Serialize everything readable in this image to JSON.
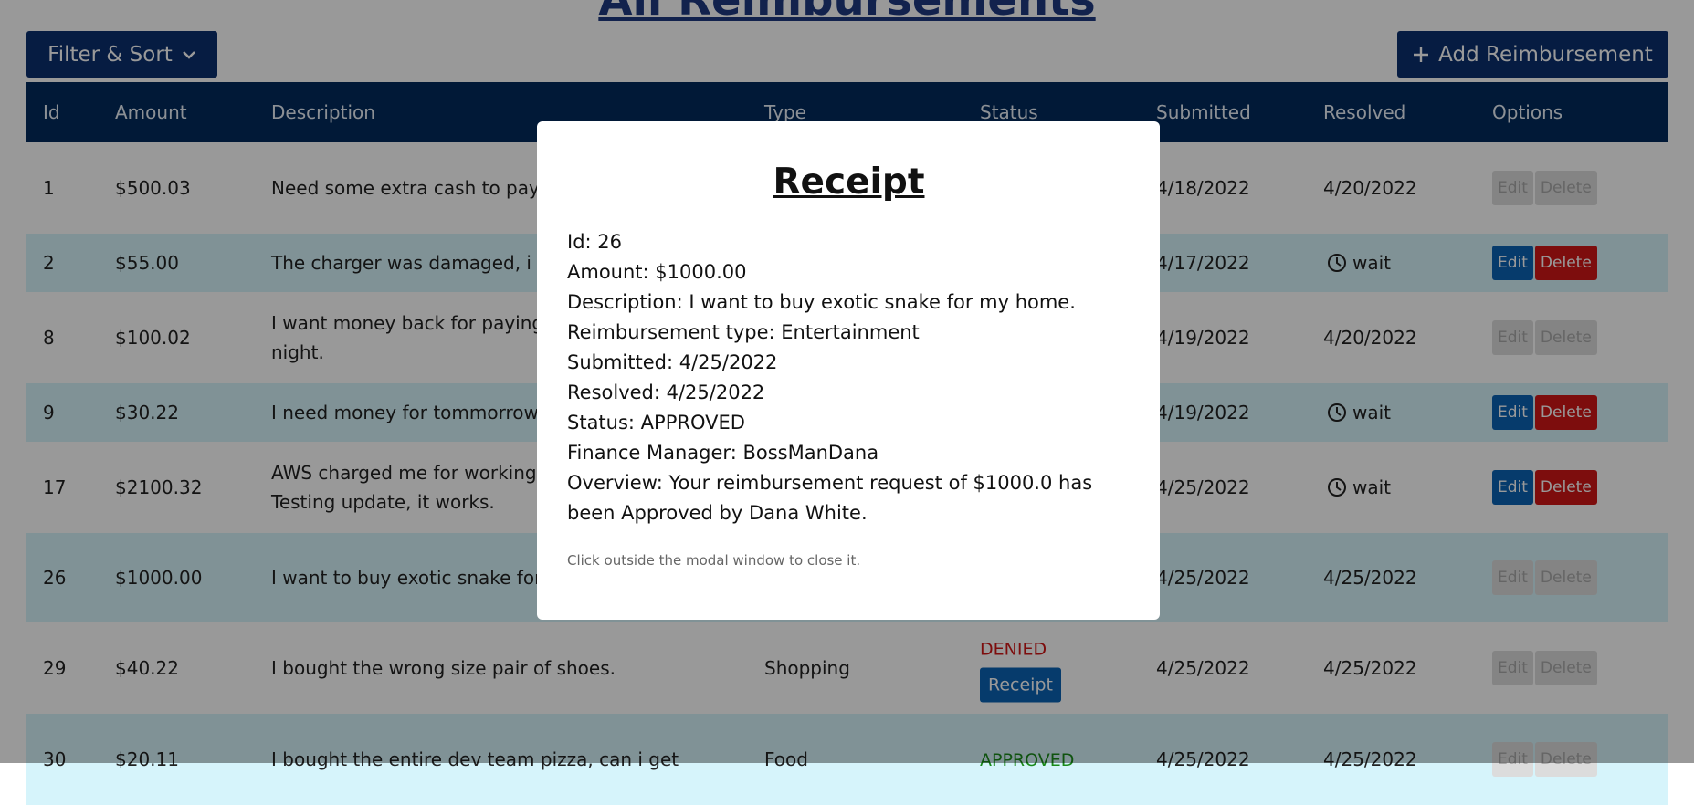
{
  "page": {
    "title": "All Reimbursements",
    "filter_label": "Filter & Sort",
    "add_label": "Add Reimbursement"
  },
  "table": {
    "columns": [
      "Id",
      "Amount",
      "Description",
      "Type",
      "Status",
      "Submitted",
      "Resolved",
      "Options"
    ],
    "rows": [
      {
        "id": "1",
        "amount": "$500.03",
        "description": "Need some extra cash to pay r",
        "submitted": "4/18/2022",
        "resolved": "4/20/2022"
      },
      {
        "id": "2",
        "amount": "$55.00",
        "description": "The charger was damaged, i w",
        "submitted": "4/17/2022",
        "resolved": "wait"
      },
      {
        "id": "8",
        "amount": "$100.02",
        "description": "I want money back for paying",
        "description2": "night.",
        "submitted": "4/19/2022",
        "resolved": "4/20/2022"
      },
      {
        "id": "9",
        "amount": "$30.22",
        "description": "I need money for tommorrow l",
        "submitted": "4/19/2022",
        "resolved": "wait"
      },
      {
        "id": "17",
        "amount": "$2100.32",
        "description": "AWS charged me for working o",
        "description2": "Testing update, it works.",
        "submitted": "4/25/2022",
        "resolved": "wait"
      },
      {
        "id": "26",
        "amount": "$1000.00",
        "description": "I want to buy exotic snake for",
        "submitted": "4/25/2022",
        "resolved": "4/25/2022"
      },
      {
        "id": "29",
        "amount": "$40.22",
        "description": "I bought the wrong size pair of shoes.",
        "type": "Shopping",
        "status": "DENIED",
        "receipt": "Receipt",
        "submitted": "4/25/2022",
        "resolved": "4/25/2022"
      },
      {
        "id": "30",
        "amount": "$20.11",
        "description": "I bought the entire dev team pizza, can i get",
        "type": "Food",
        "status": "APPROVED",
        "submitted": "4/25/2022",
        "resolved": "4/25/2022"
      }
    ],
    "edit_label": "Edit",
    "delete_label": "Delete"
  },
  "modal": {
    "title": "Receipt",
    "lines": [
      "Id: 26",
      "Amount: $1000.00",
      "Description: I want to buy exotic snake for my home.",
      "Reimbursement type: Entertainment",
      "Submitted: 4/25/2022",
      "Resolved: 4/25/2022",
      "Status: APPROVED",
      "Finance Manager: BossManDana",
      "Overview: Your reimbursement request of $1000.0 has been Approved by Dana White."
    ],
    "note": "Click outside the modal window to close it."
  },
  "colors": {
    "navy": "#022a5c",
    "button_navy": "#0a2f6e",
    "row_tint": "#d6f4fb",
    "edit": "#0b63b4",
    "delete": "#d01717",
    "denied": "#d01717",
    "approved": "#1a8a1a"
  },
  "icons": {
    "filter_chevron": "chevron-down-icon",
    "add": "plus-icon",
    "wait": "clock-icon"
  }
}
